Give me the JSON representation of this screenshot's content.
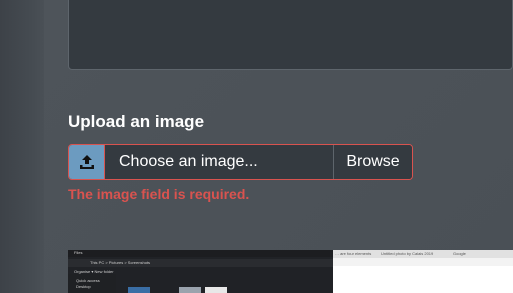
{
  "upload": {
    "title": "Upload an image",
    "placeholder": "Choose an image...",
    "browse_label": "Browse",
    "error": "The image field is required.",
    "icon": "upload-icon"
  },
  "colors": {
    "page_bg": "#4b5157",
    "panel_bg": "#343a40",
    "upload_icon_bg": "#6c9bc0",
    "error": "#d9534f",
    "text": "#ffffff"
  },
  "preview": {
    "app_title": "Files",
    "crumbs": "This PC  >  Pictures  >  Screenshots",
    "menu": "Organise ▾   New folder",
    "side_items": [
      "Quick access",
      "Desktop"
    ],
    "browser_tabs": [
      "… are four elements",
      "Untitled photo by Calais 2019",
      "Google"
    ]
  }
}
